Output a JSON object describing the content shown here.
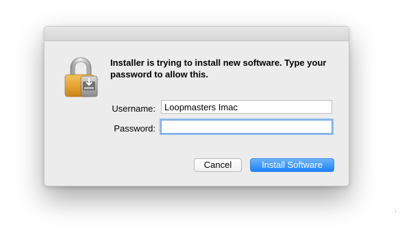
{
  "dialog": {
    "message": "Installer is trying to install new software. Type your password to allow this.",
    "icon": "lock-installer-icon"
  },
  "form": {
    "username_label": "Username:",
    "username_value": "Loopmasters Imac",
    "password_label": "Password:",
    "password_value": ""
  },
  "buttons": {
    "cancel_label": "Cancel",
    "install_label": "Install Software"
  },
  "colors": {
    "dialog_bg": "#ececec",
    "primary_button": "#1a82fb",
    "focus_ring": "#8fb9ee"
  }
}
